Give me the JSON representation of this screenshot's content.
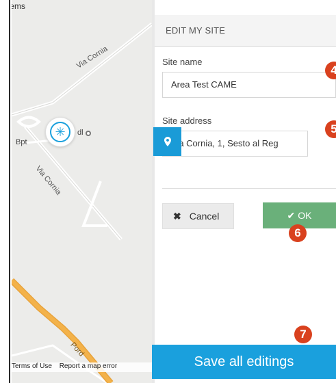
{
  "map": {
    "top_label": "tems",
    "streets": [
      "Via Cornia",
      "Via Cornia",
      "Pord"
    ],
    "place_label": "Bpt",
    "poi_label": "dl",
    "footer_terms": "Terms of Use",
    "footer_report": "Report a map error"
  },
  "panel": {
    "title": "EDIT MY SITE",
    "site_name_label": "Site name",
    "site_name_value": "Area Test CAME",
    "site_address_label": "Site address",
    "site_address_value": "Via Cornia, 1, Sesto al Reg",
    "cancel_label": "Cancel",
    "ok_label": "OK"
  },
  "save_label": "Save all editings",
  "badges": [
    "4",
    "5",
    "6",
    "7"
  ],
  "colors": {
    "accent_blue": "#1aa0dd",
    "ok_green": "#6ab07a",
    "badge_red": "#d9411e"
  }
}
